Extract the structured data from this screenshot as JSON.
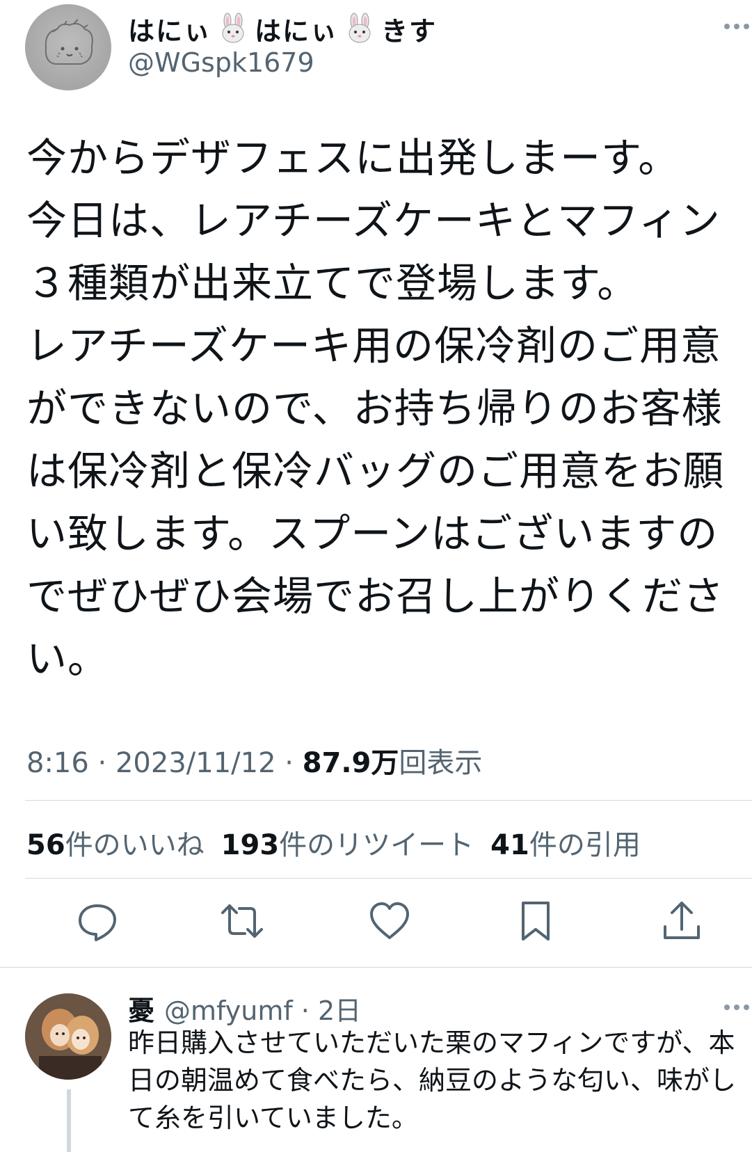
{
  "tweet": {
    "display_name_parts": [
      "はにぃ",
      "はにぃ",
      "きす"
    ],
    "handle": "@WGspk1679",
    "text_lines": [
      "今からデザフェスに出発しまーす。",
      "今日は、レアチーズケーキとマフィン",
      "３種類が出来立てで登場します。",
      "レアチーズケーキ用の保冷剤のご用意",
      "ができないので、お持ち帰りのお客様",
      "は保冷剤と保冷バッグのご用意をお願",
      "い致します。スプーンはございますの",
      "でぜひぜひ会場でお召し上がりくださ",
      "い。"
    ],
    "time": "8:16",
    "date": "2023/11/12",
    "views_count": "87.9万",
    "views_label": "回表示",
    "likes_count": "56",
    "likes_label": "件のいいね",
    "retweets_count": "193",
    "retweets_label": "件のリツイート",
    "quotes_count": "41",
    "quotes_label": "件の引用"
  },
  "actions": [
    {
      "icon": "reply-icon"
    },
    {
      "icon": "retweet-icon"
    },
    {
      "icon": "like-icon"
    },
    {
      "icon": "bookmark-icon"
    },
    {
      "icon": "share-icon"
    }
  ],
  "reply": {
    "name": "憂",
    "handle": "@mfyumf",
    "age": "2日",
    "text_lines": [
      "昨日購入させていただいた栗のマフィンですが、本",
      "日の朝温めて食べたら、納豆のような匂い、味がし",
      "て糸を引いていました。"
    ]
  },
  "colors": {
    "text": "#0f1419",
    "secondary": "#536471",
    "divider": "#d4d9de"
  }
}
